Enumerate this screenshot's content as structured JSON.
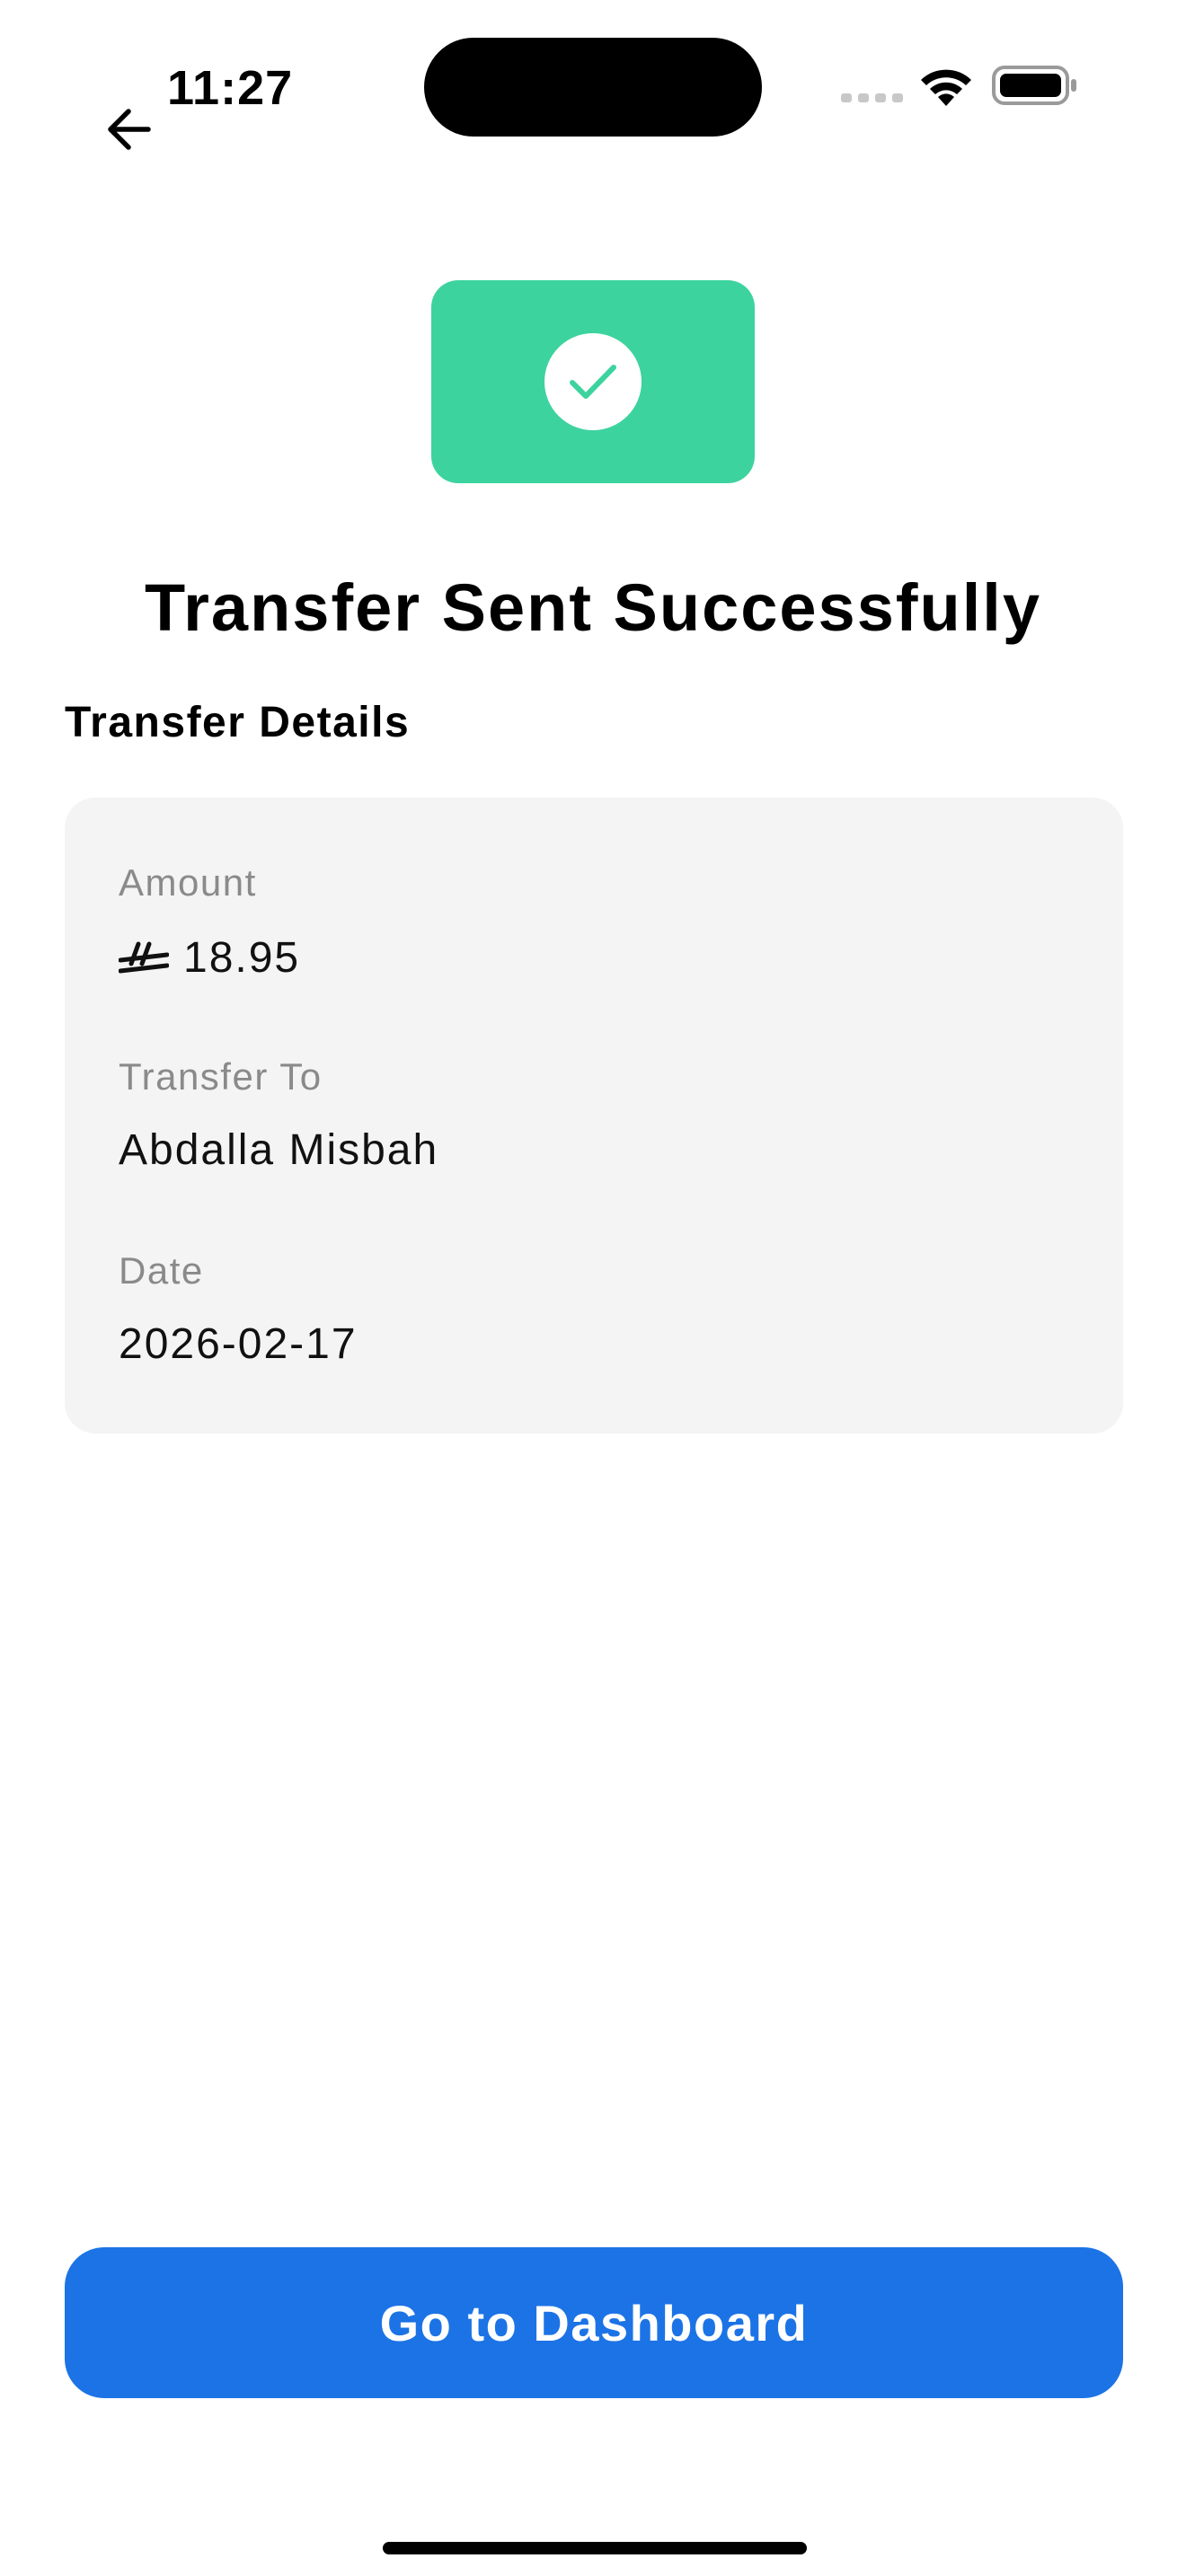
{
  "status_bar": {
    "time": "11:27",
    "icons": [
      "cellular-signal-icon",
      "wifi-icon",
      "battery-icon"
    ]
  },
  "navigation": {
    "back_icon": "arrow-left-icon"
  },
  "success": {
    "icon": "checkmark-circle-icon",
    "badge_color": "#3dd39f",
    "title": "Transfer Sent Successfully"
  },
  "details": {
    "section_title": "Transfer Details",
    "amount_label": "Amount",
    "amount_currency_icon": "saudi-riyal-icon",
    "amount_value": "18.95",
    "recipient_label": "Transfer To",
    "recipient_value": "Abdalla Misbah",
    "date_label": "Date",
    "date_value": "2026-02-17"
  },
  "actions": {
    "dashboard_label": "Go to Dashboard",
    "button_color": "#1c73e6"
  }
}
